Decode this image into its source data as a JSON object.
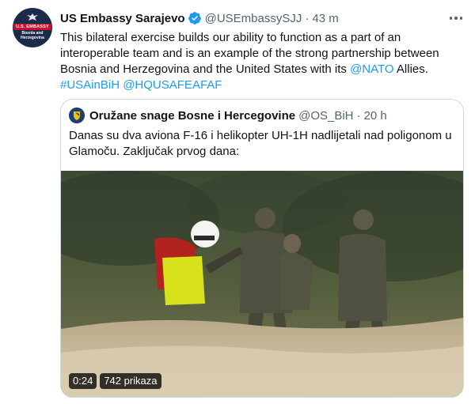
{
  "tweet": {
    "author_name": "US Embassy Sarajevo",
    "author_handle": "@USEmbassySJJ",
    "separator": "·",
    "time": "43 m",
    "avatar": {
      "badge": "U.S. EMBASSY",
      "line1": "Bosnia and",
      "line2": "Herzegovina"
    },
    "text_part1": "This bilateral exercise builds our ability to function as a part of an interoperable team and is an example of the strong partnership between Bosnia and Herzegovina and the United States with its ",
    "mention": "@NATO",
    "text_part2": " Allies.",
    "hashtag1": "#USAinBiH",
    "hashtag2": "@HQUSAFEAFAF",
    "icons": {
      "verified": "verified-badge-icon",
      "more": "more-options-icon"
    },
    "colors": {
      "link": "#1d9bf0",
      "verified": "#1d9bf0",
      "secondary_text": "#536471"
    }
  },
  "quoted": {
    "author_name": "Oružane snage Bosne i Hercegovine",
    "author_handle": "@OS_BiH",
    "separator": "·",
    "time": "20 h",
    "text": "Danas su dva aviona F-16 i helikopter UH-1H nadlijetali nad poligonom u Glamoču. Zaključak prvog dana:",
    "video": {
      "duration": "0:24",
      "views": "742 prikaza"
    }
  }
}
